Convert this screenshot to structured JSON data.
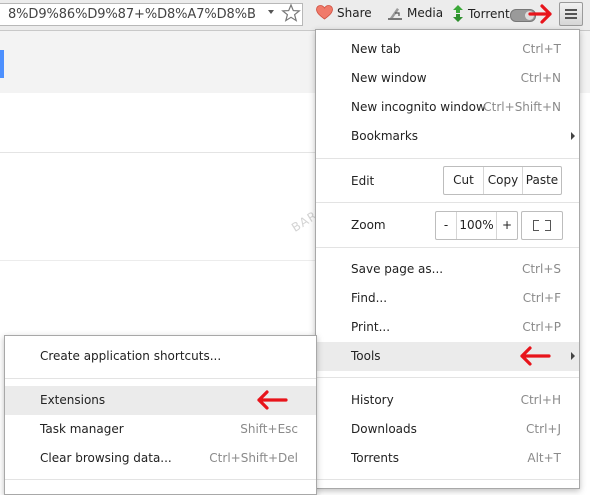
{
  "toolbar": {
    "url": "8%D9%86%D9%87+%D8%A7%D8%B",
    "extensions": [
      {
        "label": "Share",
        "icon": "heart-icon"
      },
      {
        "label": "Media",
        "icon": "media-download-icon"
      },
      {
        "label": "Torrent",
        "icon": "torrent-arrows-icon"
      }
    ],
    "menu_icon": "hamburger-menu-icon"
  },
  "watermark": "BARNAMEFA.IR",
  "main_menu": {
    "new_tab": {
      "label": "New tab",
      "shortcut": "Ctrl+T"
    },
    "new_window": {
      "label": "New window",
      "shortcut": "Ctrl+N"
    },
    "new_incognito": {
      "label": "New incognito window",
      "shortcut": "Ctrl+Shift+N"
    },
    "bookmarks": {
      "label": "Bookmarks"
    },
    "edit": {
      "label": "Edit",
      "cut": "Cut",
      "copy": "Copy",
      "paste": "Paste"
    },
    "zoom": {
      "label": "Zoom",
      "minus": "-",
      "value": "100%",
      "plus": "+"
    },
    "save_page": {
      "label": "Save page as...",
      "shortcut": "Ctrl+S"
    },
    "find": {
      "label": "Find...",
      "shortcut": "Ctrl+F"
    },
    "print": {
      "label": "Print...",
      "shortcut": "Ctrl+P"
    },
    "tools": {
      "label": "Tools"
    },
    "history": {
      "label": "History",
      "shortcut": "Ctrl+H"
    },
    "downloads": {
      "label": "Downloads",
      "shortcut": "Ctrl+J"
    },
    "torrents": {
      "label": "Torrents",
      "shortcut": "Alt+T"
    }
  },
  "tools_submenu": {
    "create_shortcuts": {
      "label": "Create application shortcuts..."
    },
    "extensions": {
      "label": "Extensions"
    },
    "task_manager": {
      "label": "Task manager",
      "shortcut": "Shift+Esc"
    },
    "clear_data": {
      "label": "Clear browsing data...",
      "shortcut": "Ctrl+Shift+Del"
    }
  },
  "colors": {
    "annotation_arrow": "#e8141b",
    "highlight": "#ebebeb"
  }
}
